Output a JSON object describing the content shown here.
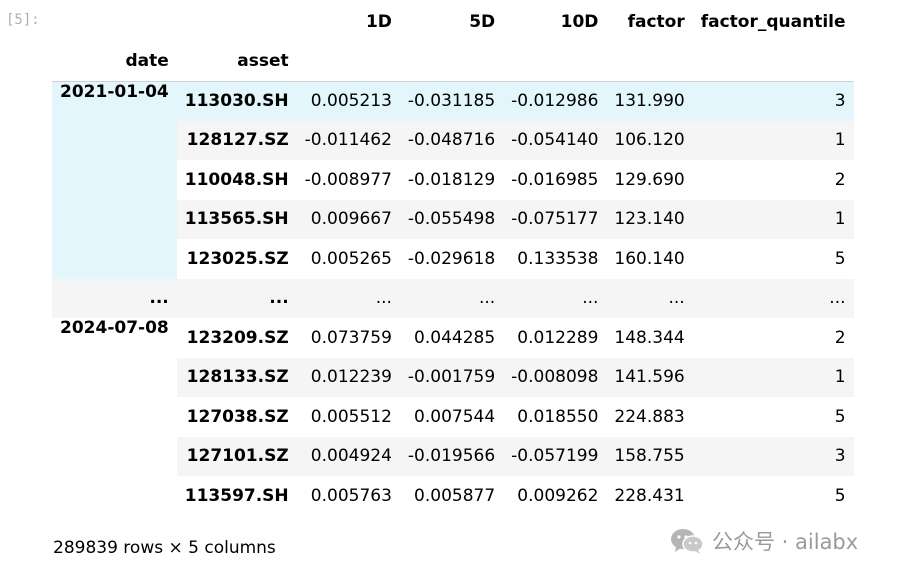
{
  "cell": {
    "prompt": "[5]:"
  },
  "table": {
    "columns": [
      "1D",
      "5D",
      "10D",
      "factor",
      "factor_quantile"
    ],
    "index_names": [
      "date",
      "asset"
    ],
    "rows": [
      {
        "date": "2021-01-04",
        "asset": "113030.SH",
        "v1d": "0.005213",
        "v5d": "-0.031185",
        "v10d": "-0.012986",
        "factor": "131.990",
        "q": "3"
      },
      {
        "date": "",
        "asset": "128127.SZ",
        "v1d": "-0.011462",
        "v5d": "-0.048716",
        "v10d": "-0.054140",
        "factor": "106.120",
        "q": "1"
      },
      {
        "date": "",
        "asset": "110048.SH",
        "v1d": "-0.008977",
        "v5d": "-0.018129",
        "v10d": "-0.016985",
        "factor": "129.690",
        "q": "2"
      },
      {
        "date": "",
        "asset": "113565.SH",
        "v1d": "0.009667",
        "v5d": "-0.055498",
        "v10d": "-0.075177",
        "factor": "123.140",
        "q": "1"
      },
      {
        "date": "",
        "asset": "123025.SZ",
        "v1d": "0.005265",
        "v5d": "-0.029618",
        "v10d": "0.133538",
        "factor": "160.140",
        "q": "5"
      },
      {
        "date": "...",
        "asset": "...",
        "v1d": "...",
        "v5d": "...",
        "v10d": "...",
        "factor": "...",
        "q": "..."
      },
      {
        "date": "2024-07-08",
        "asset": "123209.SZ",
        "v1d": "0.073759",
        "v5d": "0.044285",
        "v10d": "0.012289",
        "factor": "148.344",
        "q": "2"
      },
      {
        "date": "",
        "asset": "128133.SZ",
        "v1d": "0.012239",
        "v5d": "-0.001759",
        "v10d": "-0.008098",
        "factor": "141.596",
        "q": "1"
      },
      {
        "date": "",
        "asset": "127038.SZ",
        "v1d": "0.005512",
        "v5d": "0.007544",
        "v10d": "0.018550",
        "factor": "224.883",
        "q": "5"
      },
      {
        "date": "",
        "asset": "127101.SZ",
        "v1d": "0.004924",
        "v5d": "-0.019566",
        "v10d": "-0.057199",
        "factor": "158.755",
        "q": "3"
      },
      {
        "date": "",
        "asset": "113597.SH",
        "v1d": "0.005763",
        "v5d": "0.005877",
        "v10d": "0.009262",
        "factor": "228.431",
        "q": "5"
      }
    ]
  },
  "footer": {
    "shape": "289839 rows × 5 columns"
  },
  "watermark": {
    "text": "公众号 · ailabx",
    "icon": "wechat-icon"
  },
  "colors": {
    "highlight": "#e3f6fc",
    "stripe": "#f5f5f5",
    "prompt": "#b0b0b0"
  }
}
